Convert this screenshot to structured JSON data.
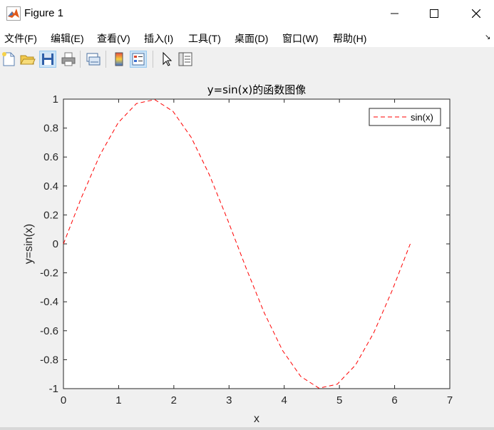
{
  "window": {
    "title": "Figure 1",
    "icon": "matlab-icon",
    "controls": [
      "minimize-icon",
      "maximize-icon",
      "close-icon"
    ]
  },
  "menu": {
    "items": [
      "文件(F)",
      "编辑(E)",
      "查看(V)",
      "插入(I)",
      "工具(T)",
      "桌面(D)",
      "窗口(W)",
      "帮助(H)"
    ]
  },
  "toolbar": {
    "icons": [
      "new-figure-icon",
      "open-file-icon",
      "save-icon",
      "print-icon",
      "link-plot-icon",
      "colorbar-icon",
      "legend-icon",
      "pointer-icon",
      "property-inspector-icon"
    ]
  },
  "chart_data": {
    "type": "line",
    "title": "y=sin(x)的函数图像",
    "xlabel": "x",
    "ylabel": "y=sin(x)",
    "xlim": [
      0,
      7
    ],
    "ylim": [
      -1,
      1
    ],
    "xticks": [
      "0",
      "1",
      "2",
      "3",
      "4",
      "5",
      "6",
      "7"
    ],
    "yticks": [
      "-1",
      "-0.8",
      "-0.6",
      "-0.4",
      "-0.2",
      "0",
      "0.2",
      "0.4",
      "0.6",
      "0.8",
      "1"
    ],
    "grid": false,
    "legend_position": "top-right",
    "series": [
      {
        "name": "sin(x)",
        "color": "#ff0000",
        "line_style": "dashed",
        "x": [
          0,
          0.3307,
          0.6614,
          0.9921,
          1.3228,
          1.6535,
          1.9842,
          2.3149,
          2.6456,
          2.9762,
          3.3069,
          3.6376,
          3.9683,
          4.299,
          4.6297,
          4.9604,
          5.2911,
          5.6218,
          5.9525,
          6.2832
        ],
        "y": [
          0,
          0.3247,
          0.6142,
          0.8372,
          0.9694,
          0.9966,
          0.9158,
          0.7357,
          0.4759,
          0.1646,
          -0.1646,
          -0.4759,
          -0.7357,
          -0.9158,
          -0.9966,
          -0.9694,
          -0.8372,
          -0.6142,
          -0.3247,
          0
        ]
      }
    ]
  }
}
